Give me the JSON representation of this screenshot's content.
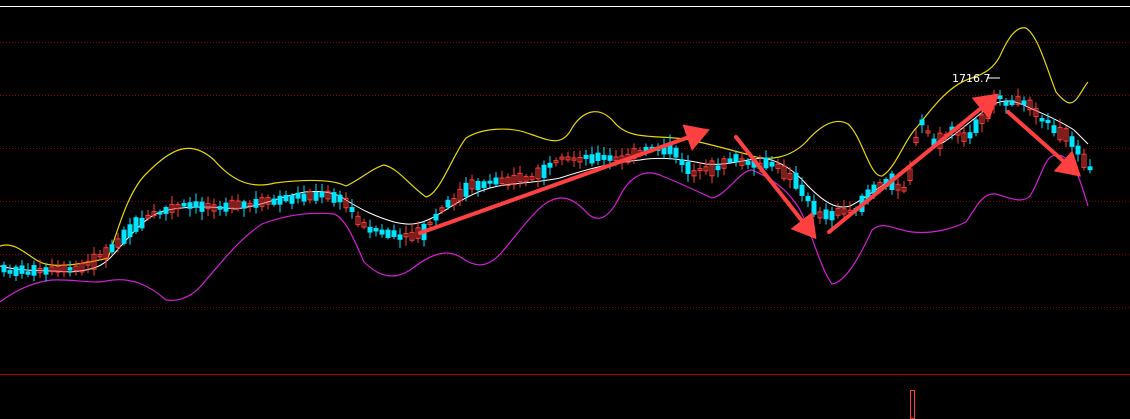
{
  "chart_data": {
    "type": "candlestick",
    "indicator": "bollinger-bands",
    "annotations": {
      "high_label": "1716.7",
      "trend_arrows": [
        {
          "direction": "up"
        },
        {
          "direction": "up"
        },
        {
          "direction": "down"
        },
        {
          "direction": "up"
        },
        {
          "direction": "down"
        }
      ]
    },
    "grid": true,
    "colors": {
      "background": "#000000",
      "up_candle": "#ff3b3b",
      "down_candle": "#00e5ff",
      "upper_band": "#e6d800",
      "middle_band": "#ffffff",
      "lower_band": "#d21ed2",
      "gridline": "#8b0000",
      "arrow": "#ff4040"
    }
  }
}
